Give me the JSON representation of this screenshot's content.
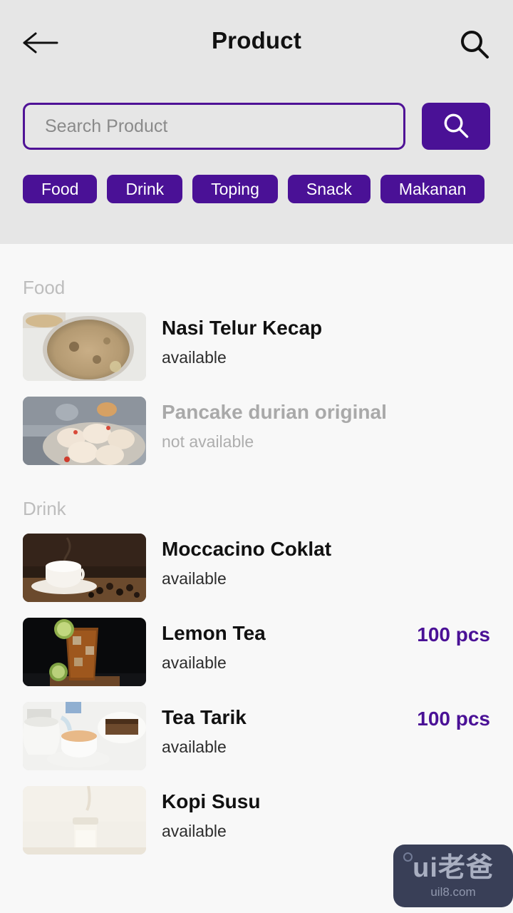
{
  "appbar": {
    "title": "Product",
    "back_icon": "arrow-left-icon",
    "search_icon": "search-icon"
  },
  "search": {
    "placeholder": "Search Product",
    "value": "",
    "submit_icon": "search-icon"
  },
  "categories": [
    {
      "label": "Food"
    },
    {
      "label": "Drink"
    },
    {
      "label": "Toping"
    },
    {
      "label": "Snack"
    },
    {
      "label": "Makanan"
    }
  ],
  "sections": [
    {
      "label": "Food",
      "items": [
        {
          "title": "Nasi Telur Kecap",
          "status": "available",
          "available": true,
          "qty": "",
          "image": "rice-bowl-photo"
        },
        {
          "title": "Pancake durian original",
          "status": "not available",
          "available": false,
          "qty": "",
          "image": "pancake-durian-photo"
        }
      ]
    },
    {
      "label": "Drink",
      "items": [
        {
          "title": "Moccacino Coklat",
          "status": "available",
          "available": true,
          "qty": "",
          "image": "coffee-cup-photo"
        },
        {
          "title": "Lemon Tea",
          "status": "available",
          "available": true,
          "qty": "100 pcs",
          "image": "iced-lemon-tea-photo"
        },
        {
          "title": "Tea Tarik",
          "status": "available",
          "available": true,
          "qty": "100 pcs",
          "image": "tea-pouring-photo"
        },
        {
          "title": "Kopi Susu",
          "status": "available",
          "available": true,
          "qty": "",
          "image": "milk-bottle-photo"
        }
      ]
    }
  ],
  "watermark": {
    "main": "ui老爸",
    "sub": "uil8.com"
  },
  "colors": {
    "accent": "#4a1196",
    "header_bg": "#e6e6e6",
    "content_bg": "#f8f8f8",
    "muted_text": "#aeaeae"
  }
}
